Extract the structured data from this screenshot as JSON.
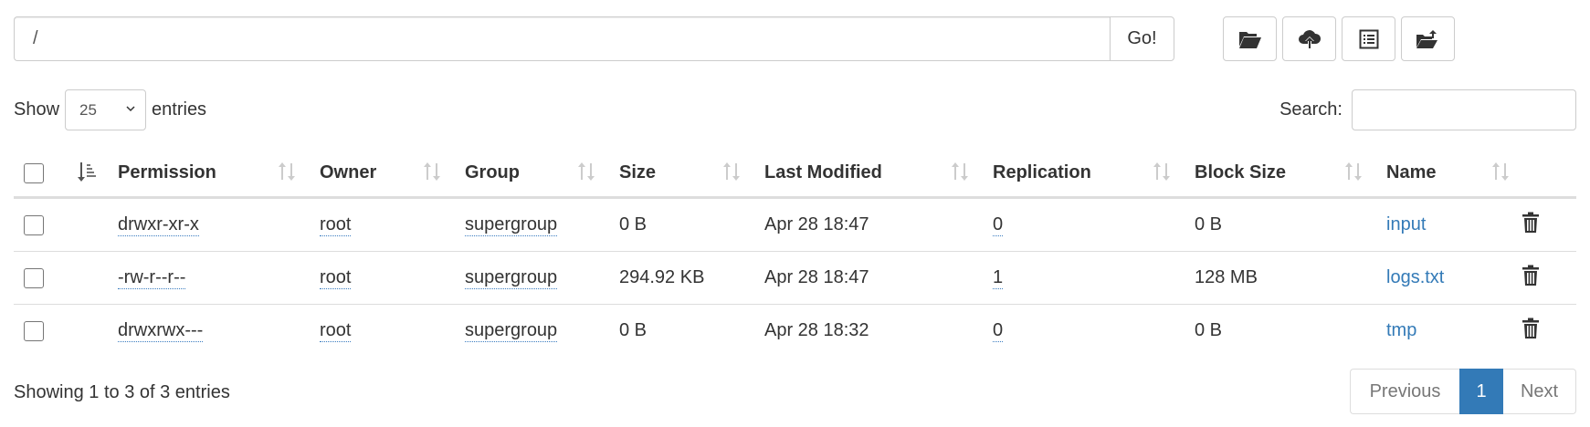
{
  "toolbar": {
    "path_value": "/",
    "go_label": "Go!",
    "buttons": [
      {
        "icon": "folder-open-icon"
      },
      {
        "icon": "cloud-upload-icon"
      },
      {
        "icon": "list-alt-icon"
      },
      {
        "icon": "folder-move-icon"
      }
    ]
  },
  "length": {
    "show_label": "Show",
    "value": "25",
    "entries_label": "entries"
  },
  "search": {
    "label": "Search:",
    "value": ""
  },
  "table": {
    "columns": [
      "Permission",
      "Owner",
      "Group",
      "Size",
      "Last Modified",
      "Replication",
      "Block Size",
      "Name"
    ],
    "rows": [
      {
        "permission": "drwxr-xr-x",
        "owner": "root",
        "group": "supergroup",
        "size": "0 B",
        "modified": "Apr 28 18:47",
        "replication": "0",
        "block_size": "0 B",
        "name": "input"
      },
      {
        "permission": "-rw-r--r--",
        "owner": "root",
        "group": "supergroup",
        "size": "294.92 KB",
        "modified": "Apr 28 18:47",
        "replication": "1",
        "block_size": "128 MB",
        "name": "logs.txt"
      },
      {
        "permission": "drwxrwx---",
        "owner": "root",
        "group": "supergroup",
        "size": "0 B",
        "modified": "Apr 28 18:32",
        "replication": "0",
        "block_size": "0 B",
        "name": "tmp"
      }
    ]
  },
  "footer": {
    "info": "Showing 1 to 3 of 3 entries",
    "previous": "Previous",
    "current_page": "1",
    "next": "Next"
  },
  "colors": {
    "accent": "#337ab7",
    "border": "#dddddd"
  }
}
